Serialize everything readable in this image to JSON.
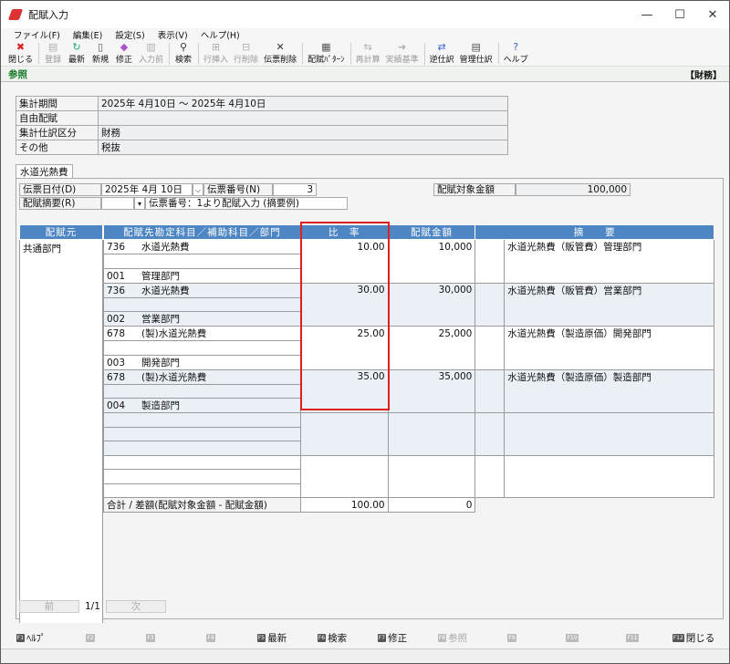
{
  "window": {
    "title": "配賦入力",
    "min": "—",
    "max": "☐",
    "close": "✕"
  },
  "menu": [
    "ファイル(F)",
    "編集(E)",
    "設定(S)",
    "表示(V)",
    "ヘルプ(H)"
  ],
  "toolbar": [
    {
      "label": "閉じる",
      "icon": "close-icon",
      "glyph": "✖",
      "color": "#d22",
      "enabled": true
    },
    {
      "label": "登録",
      "icon": "register-icon",
      "glyph": "▤",
      "color": "#999",
      "enabled": false
    },
    {
      "label": "最新",
      "icon": "refresh-icon",
      "glyph": "↻",
      "color": "#2a7",
      "enabled": true
    },
    {
      "label": "新規",
      "icon": "new-doc-icon",
      "glyph": "▯",
      "color": "#555",
      "enabled": true
    },
    {
      "label": "修正",
      "icon": "edit-icon",
      "glyph": "◆",
      "color": "#a5c",
      "enabled": true
    },
    {
      "label": "入力前",
      "icon": "previous-input-icon",
      "glyph": "▥",
      "color": "#999",
      "enabled": false
    },
    {
      "label": "検索",
      "icon": "search-icon",
      "glyph": "⚲",
      "color": "#333",
      "enabled": true
    },
    {
      "label": "行挿入",
      "icon": "insert-row-icon",
      "glyph": "⊞",
      "color": "#999",
      "enabled": false
    },
    {
      "label": "行削除",
      "icon": "delete-row-icon",
      "glyph": "⊟",
      "color": "#999",
      "enabled": false
    },
    {
      "label": "伝票削除",
      "icon": "delete-slip-icon",
      "glyph": "✕",
      "color": "#333",
      "enabled": true
    },
    {
      "label": "配賦ﾊﾟﾀｰﾝ",
      "icon": "pattern-icon",
      "glyph": "▦",
      "color": "#555",
      "enabled": true
    },
    {
      "label": "再計算",
      "icon": "recalc-icon",
      "glyph": "⇆",
      "color": "#999",
      "enabled": false
    },
    {
      "label": "実績基準",
      "icon": "results-basis-icon",
      "glyph": "➜",
      "color": "#999",
      "enabled": false
    },
    {
      "label": "逆仕訳",
      "icon": "reverse-entry-icon",
      "glyph": "⇄",
      "color": "#36c",
      "enabled": true
    },
    {
      "label": "管理仕訳",
      "icon": "management-entry-icon",
      "glyph": "▤",
      "color": "#555",
      "enabled": true
    },
    {
      "label": "ヘルプ",
      "icon": "help-icon",
      "glyph": "?",
      "color": "#36c",
      "enabled": true
    }
  ],
  "mode": {
    "left": "参照",
    "right": "【財務】"
  },
  "info": [
    {
      "k": "集計期間",
      "v": "2025年 4月10日 ～ 2025年 4月10日"
    },
    {
      "k": "自由配賦",
      "v": ""
    },
    {
      "k": "集計仕訳区分",
      "v": "財務"
    },
    {
      "k": "その他",
      "v": "税抜"
    }
  ],
  "tab": "水道光熱費",
  "form": {
    "date_label": "伝票日付(D)",
    "date": "2025年  4月 10日",
    "slip_label": "伝票番号(N)",
    "slip": "3",
    "target_label": "配賦対象金額",
    "target": "100,000",
    "summary_label": "配賦摘要(R)",
    "summary_code": "",
    "summary": "伝票番号：1より配賦入力 (摘要例)"
  },
  "grid": {
    "headers": {
      "source": "配賦元",
      "account": "配賦先勘定科目／補助科目／部門",
      "ratio": "比　率",
      "amount": "配賦金額",
      "desc": "摘　　要"
    },
    "source": "共通部門",
    "rows": [
      {
        "code": "736",
        "name": "水道光熱費",
        "ratio": "10.00",
        "amount": "10,000",
        "desc": "水道光熱費（販管費）管理部門",
        "dept_code": "001",
        "dept": "管理部門"
      },
      {
        "code": "736",
        "name": "水道光熱費",
        "ratio": "30.00",
        "amount": "30,000",
        "desc": "水道光熱費（販管費）営業部門",
        "dept_code": "002",
        "dept": "営業部門"
      },
      {
        "code": "678",
        "name": "(製)水道光熱費",
        "ratio": "25.00",
        "amount": "25,000",
        "desc": "水道光熱費（製造原価）開発部門",
        "dept_code": "003",
        "dept": "開発部門"
      },
      {
        "code": "678",
        "name": "(製)水道光熱費",
        "ratio": "35.00",
        "amount": "35,000",
        "desc": "水道光熱費（製造原価）製造部門",
        "dept_code": "004",
        "dept": "製造部門"
      }
    ],
    "total_label": "合計 / 差額(配賦対象金額 - 配賦金額)",
    "total_ratio": "100.00",
    "total_diff": "0"
  },
  "pager": {
    "prev": "前",
    "page": "1/1",
    "next": "次"
  },
  "fkeys": [
    {
      "k": "F1",
      "label": "ﾍﾙﾌﾟ",
      "enabled": true
    },
    {
      "k": "F2",
      "label": "",
      "enabled": false
    },
    {
      "k": "F3",
      "label": "",
      "enabled": false
    },
    {
      "k": "F4",
      "label": "",
      "enabled": false
    },
    {
      "k": "F5",
      "label": "最新",
      "enabled": true
    },
    {
      "k": "F6",
      "label": "検索",
      "enabled": true
    },
    {
      "k": "F7",
      "label": "修正",
      "enabled": true
    },
    {
      "k": "F8",
      "label": "参照",
      "enabled": false
    },
    {
      "k": "F9",
      "label": "",
      "enabled": false
    },
    {
      "k": "F10",
      "label": "",
      "enabled": false
    },
    {
      "k": "F11",
      "label": "",
      "enabled": false
    },
    {
      "k": "F12",
      "label": "閉じる",
      "enabled": true
    }
  ]
}
